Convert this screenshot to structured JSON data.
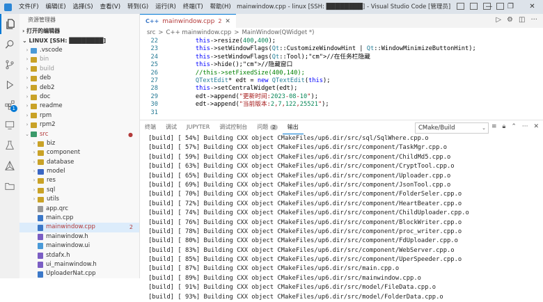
{
  "titlebar": {
    "menu": [
      "文件(F)",
      "编辑(E)",
      "选择(S)",
      "查看(V)",
      "转到(G)",
      "运行(R)",
      "终端(T)",
      "帮助(H)"
    ],
    "window_title": "mainwindow.cpp - linux [SSH: ████████] - Visual Studio Code [管理员]",
    "controls": [
      "—",
      "❐",
      "✕"
    ]
  },
  "activity": {
    "items": [
      "explorer-icon",
      "search-icon",
      "source-control-icon",
      "run-debug-icon",
      "extensions-icon",
      "remote-explorer-icon",
      "testing-icon",
      "cmake-icon",
      "folder-icon"
    ],
    "extensions_badge": "1"
  },
  "sidebar": {
    "title": "资源管理器",
    "open_editors": "打开的编辑器",
    "workspace": "LINUX [SSH: ████████]",
    "tree": [
      {
        "label": ".vscode",
        "type": "folder",
        "depth": 1,
        "color": "#4a9ad8"
      },
      {
        "label": "bin",
        "type": "folder",
        "depth": 1,
        "color": "#c9a227",
        "dim": true
      },
      {
        "label": "build",
        "type": "folder",
        "depth": 1,
        "color": "#c9a227",
        "dim": true
      },
      {
        "label": "deb",
        "type": "folder",
        "depth": 1,
        "color": "#c9a227"
      },
      {
        "label": "deb2",
        "type": "folder",
        "depth": 1,
        "color": "#c9a227"
      },
      {
        "label": "doc",
        "type": "folder",
        "depth": 1,
        "color": "#c9a227"
      },
      {
        "label": "readme",
        "type": "folder",
        "depth": 1,
        "color": "#c9a227"
      },
      {
        "label": "rpm",
        "type": "folder",
        "depth": 1,
        "color": "#c9a227"
      },
      {
        "label": "rpm2",
        "type": "folder",
        "depth": 1,
        "color": "#c9a227"
      },
      {
        "label": "src",
        "type": "folder-open",
        "depth": 1,
        "color": "#3a9a6a",
        "mod": "●",
        "red": true
      },
      {
        "label": "biz",
        "type": "folder",
        "depth": 2,
        "color": "#c9a227"
      },
      {
        "label": "component",
        "type": "folder",
        "depth": 2,
        "color": "#c9a227"
      },
      {
        "label": "database",
        "type": "folder",
        "depth": 2,
        "color": "#c9a227"
      },
      {
        "label": "model",
        "type": "folder",
        "depth": 2,
        "color": "#3a66c4"
      },
      {
        "label": "res",
        "type": "folder",
        "depth": 2,
        "color": "#c9a227"
      },
      {
        "label": "sql",
        "type": "folder",
        "depth": 2,
        "color": "#c9a227"
      },
      {
        "label": "utils",
        "type": "folder",
        "depth": 2,
        "color": "#c9a227"
      },
      {
        "label": "app.qrc",
        "type": "file",
        "depth": 2,
        "color": "#999999"
      },
      {
        "label": "main.cpp",
        "type": "file",
        "depth": 2,
        "color": "#3c78c8"
      },
      {
        "label": "mainwindow.cpp",
        "type": "file",
        "depth": 2,
        "color": "#3c78c8",
        "mod": "2",
        "red": true,
        "selected": true
      },
      {
        "label": "mainwindow.h",
        "type": "file",
        "depth": 2,
        "color": "#7b5ec4"
      },
      {
        "label": "mainwindow.ui",
        "type": "file",
        "depth": 2,
        "color": "#4a9ad8"
      },
      {
        "label": "stdafx.h",
        "type": "file",
        "depth": 2,
        "color": "#7b5ec4"
      },
      {
        "label": "ui_mainwindow.h",
        "type": "file",
        "depth": 2,
        "color": "#7b5ec4"
      },
      {
        "label": "UploaderNat.cpp",
        "type": "file",
        "depth": 2,
        "color": "#3c78c8"
      }
    ]
  },
  "editor": {
    "tab": {
      "icon": "C++",
      "name": "mainwindow.cpp",
      "problems": "2"
    },
    "breadcrumb": [
      "src",
      ">",
      "C++ mainwindow.cpp",
      ">",
      "MainWindow(QWidget *)"
    ],
    "lines": [
      {
        "n": "22",
        "code": "    this->resize(400,400);"
      },
      {
        "n": "23",
        "code": "    this->setWindowFlags(Qt::CustomizeWindowHint | Qt::WindowMinimizeButtonHint);"
      },
      {
        "n": "24",
        "code": "    this->setWindowFlags(Qt::Tool);//在任务栏隐藏"
      },
      {
        "n": "25",
        "code": "    this->hide();//隐藏窗口"
      },
      {
        "n": "26",
        "code": "    //this->setFixedSize(400,140);"
      },
      {
        "n": "27",
        "code": "    QTextEdit* edt = new QTextEdit(this);"
      },
      {
        "n": "28",
        "code": "    this->setCentralWidget(edt);"
      },
      {
        "n": "29",
        "code": "    edt->append(\"更新时间:2023-08-10\");"
      },
      {
        "n": "30",
        "code": "    edt->append(\"当前版本:2,7,122,25521\");"
      },
      {
        "n": "31",
        "code": "    "
      }
    ]
  },
  "panel": {
    "tabs": [
      "终端",
      "调试",
      "JUPYTER",
      "调试控制台",
      "问题",
      "输出"
    ],
    "problems_badge": "2",
    "active_tab": "输出",
    "channel": "CMake/Build",
    "output": [
      "[build] [ 54%] Building CXX object CMakeFiles/up6.dir/src/sql/SqlWhere.cpp.o",
      "[build] [ 57%] Building CXX object CMakeFiles/up6.dir/src/component/TaskMgr.cpp.o",
      "[build] [ 59%] Building CXX object CMakeFiles/up6.dir/src/component/ChildMd5.cpp.o",
      "[build] [ 63%] Building CXX object CMakeFiles/up6.dir/src/component/CryptTool.cpp.o",
      "[build] [ 65%] Building CXX object CMakeFiles/up6.dir/src/component/Uploader.cpp.o",
      "[build] [ 69%] Building CXX object CMakeFiles/up6.dir/src/component/JsonTool.cpp.o",
      "[build] [ 70%] Building CXX object CMakeFiles/up6.dir/src/component/FolderSeler.cpp.o",
      "[build] [ 72%] Building CXX object CMakeFiles/up6.dir/src/component/HeartBeater.cpp.o",
      "[build] [ 74%] Building CXX object CMakeFiles/up6.dir/src/component/ChildUploader.cpp.o",
      "[build] [ 76%] Building CXX object CMakeFiles/up6.dir/src/component/BlockWriter.cpp.o",
      "[build] [ 78%] Building CXX object CMakeFiles/up6.dir/src/component/proc_writer.cpp.o",
      "[build] [ 80%] Building CXX object CMakeFiles/up6.dir/src/component/FdUploader.cpp.o",
      "[build] [ 83%] Building CXX object CMakeFiles/up6.dir/src/component/WebServer.cpp.o",
      "[build] [ 85%] Building CXX object CMakeFiles/up6.dir/src/component/UperSpeeder.cpp.o",
      "[build] [ 87%] Building CXX object CMakeFiles/up6.dir/src/main.cpp.o",
      "[build] [ 89%] Building CXX object CMakeFiles/up6.dir/src/mainwindow.cpp.o",
      "[build] [ 91%] Building CXX object CMakeFiles/up6.dir/src/model/FileData.cpp.o",
      "[build] [ 93%] Building CXX object CMakeFiles/up6.dir/src/model/FolderData.cpp.o"
    ]
  }
}
